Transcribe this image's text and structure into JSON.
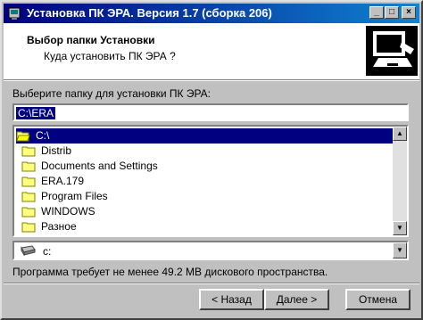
{
  "window": {
    "title": "Установка ПК ЭРА. Версия 1.7 (сборка 206)"
  },
  "titlebar_buttons": {
    "minimize": "_",
    "maximize": "□",
    "close": "×"
  },
  "header": {
    "title": "Выбор папки Установки",
    "subtitle": "Куда установить ПК ЭРА ?"
  },
  "folder_prompt": "Выберите папку для установки ПК ЭРА:",
  "path_value": "C:\\ERA",
  "tree": {
    "items": [
      {
        "label": "C:\\",
        "selected": true,
        "icon": "open-folder-icon"
      },
      {
        "label": "Distrib"
      },
      {
        "label": "Documents and Settings"
      },
      {
        "label": "ERA.179"
      },
      {
        "label": "Program Files"
      },
      {
        "label": "WINDOWS"
      },
      {
        "label": "Разное"
      }
    ]
  },
  "drive": {
    "value": "c:",
    "icon": "hard-drive-icon"
  },
  "space_text": "Программа требует не менее 49.2 MB дискового пространства.",
  "buttons": {
    "back": "< Назад",
    "next": "Далее >",
    "cancel": "Отмена"
  }
}
